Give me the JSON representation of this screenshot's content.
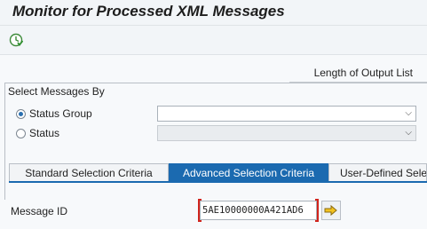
{
  "window": {
    "title": "Monitor for Processed XML Messages"
  },
  "toolbar": {
    "execute_icon": "execute-clock-icon"
  },
  "output_list": {
    "label": "Length of Output List"
  },
  "select_group": {
    "title": "Select Messages By",
    "options": [
      {
        "label": "Status Group",
        "selected": true
      },
      {
        "label": "Status",
        "selected": false
      }
    ],
    "status_group_value": "",
    "status_value": ""
  },
  "tabs": [
    {
      "label": "Standard Selection Criteria",
      "active": false
    },
    {
      "label": "Advanced Selection Criteria",
      "active": true
    },
    {
      "label": "User-Defined Selection",
      "active": false
    }
  ],
  "advanced": {
    "message_id_label": "Message ID",
    "message_id_value": "5AE10000000A421AD6",
    "multiple_selection_icon": "arrow-right-icon"
  },
  "colors": {
    "active_tab": "#1b6ab0",
    "focus_bracket": "#d1241c",
    "background": "#f2f5f8"
  }
}
